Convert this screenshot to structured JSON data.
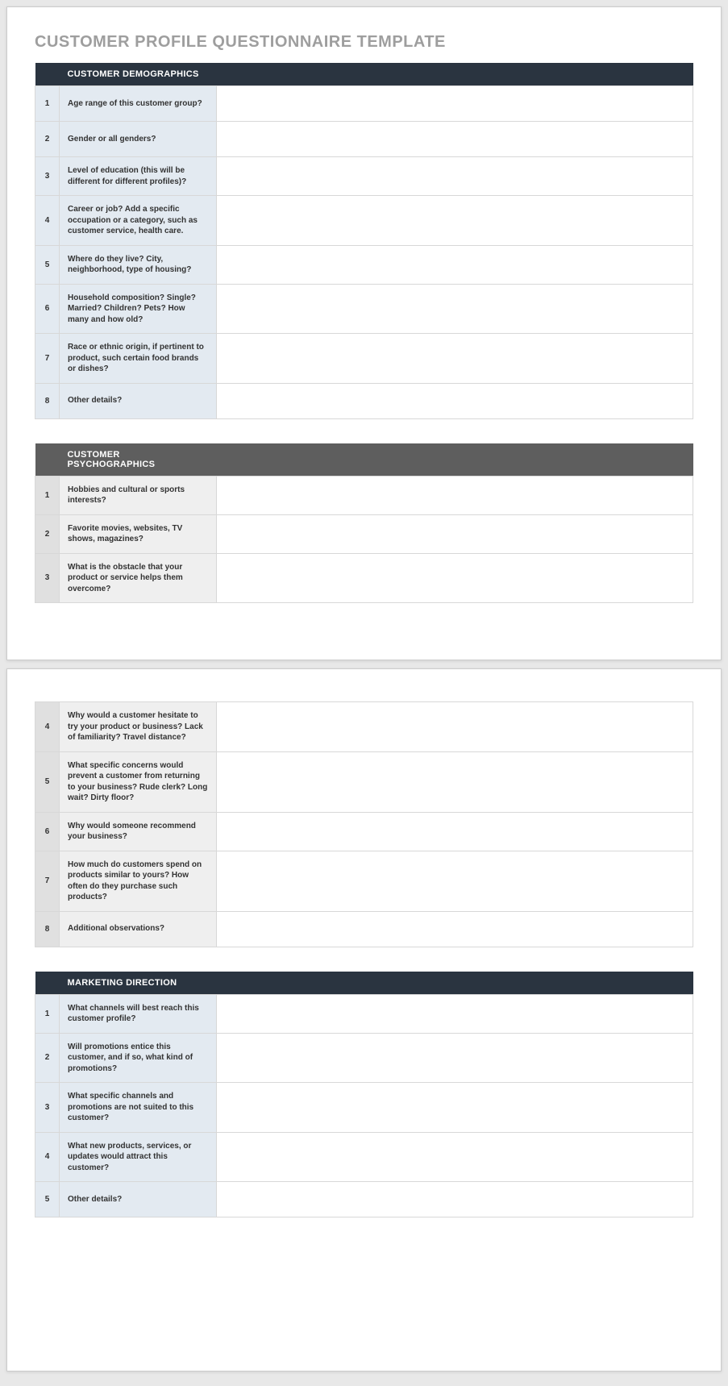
{
  "title": "CUSTOMER PROFILE QUESTIONNAIRE TEMPLATE",
  "sections": [
    {
      "header": "CUSTOMER DEMOGRAPHICS",
      "style": "dark",
      "rows": [
        {
          "num": "1",
          "q": "Age range of this customer group?",
          "a": ""
        },
        {
          "num": "2",
          "q": "Gender or all genders?",
          "a": ""
        },
        {
          "num": "3",
          "q": "Level of education (this will be different for different profiles)?",
          "a": ""
        },
        {
          "num": "4",
          "q": "Career or job? Add a specific occupation or a category, such as customer service, health care.",
          "a": ""
        },
        {
          "num": "5",
          "q": "Where do they live? City, neighborhood, type of housing?",
          "a": ""
        },
        {
          "num": "6",
          "q": "Household composition? Single? Married? Children? Pets? How many and how old?",
          "a": ""
        },
        {
          "num": "7",
          "q": "Race or ethnic origin, if pertinent to product, such certain food brands or dishes?",
          "a": ""
        },
        {
          "num": "8",
          "q": "Other details?",
          "a": ""
        }
      ]
    },
    {
      "header": "CUSTOMER PSYCHOGRAPHICS",
      "style": "gray",
      "rows_page1": [
        {
          "num": "1",
          "q": "Hobbies and cultural or sports interests?",
          "a": ""
        },
        {
          "num": "2",
          "q": "Favorite movies, websites, TV shows, magazines?",
          "a": ""
        },
        {
          "num": "3",
          "q": "What is the obstacle that your product or service helps them overcome?",
          "a": ""
        }
      ],
      "rows_page2": [
        {
          "num": "4",
          "q": "Why would a customer hesitate to try your product or business? Lack of familiarity? Travel distance?",
          "a": ""
        },
        {
          "num": "5",
          "q": "What specific concerns would prevent a customer from returning to your business? Rude clerk? Long wait? Dirty floor?",
          "a": ""
        },
        {
          "num": "6",
          "q": "Why would someone recommend your business?",
          "a": ""
        },
        {
          "num": "7",
          "q": "How much do customers spend on products similar to yours? How often do they purchase such products?",
          "a": ""
        },
        {
          "num": "8",
          "q": "Additional observations?",
          "a": ""
        }
      ]
    },
    {
      "header": "MARKETING DIRECTION",
      "style": "dark",
      "rows": [
        {
          "num": "1",
          "q": "What channels will best reach this customer profile?",
          "a": ""
        },
        {
          "num": "2",
          "q": "Will promotions entice this customer, and if so, what kind of promotions?",
          "a": ""
        },
        {
          "num": "3",
          "q": "What specific channels and promotions are not suited to this customer?",
          "a": ""
        },
        {
          "num": "4",
          "q": "What new products, services, or updates would attract this customer?",
          "a": ""
        },
        {
          "num": "5",
          "q": "Other details?",
          "a": ""
        }
      ]
    }
  ]
}
